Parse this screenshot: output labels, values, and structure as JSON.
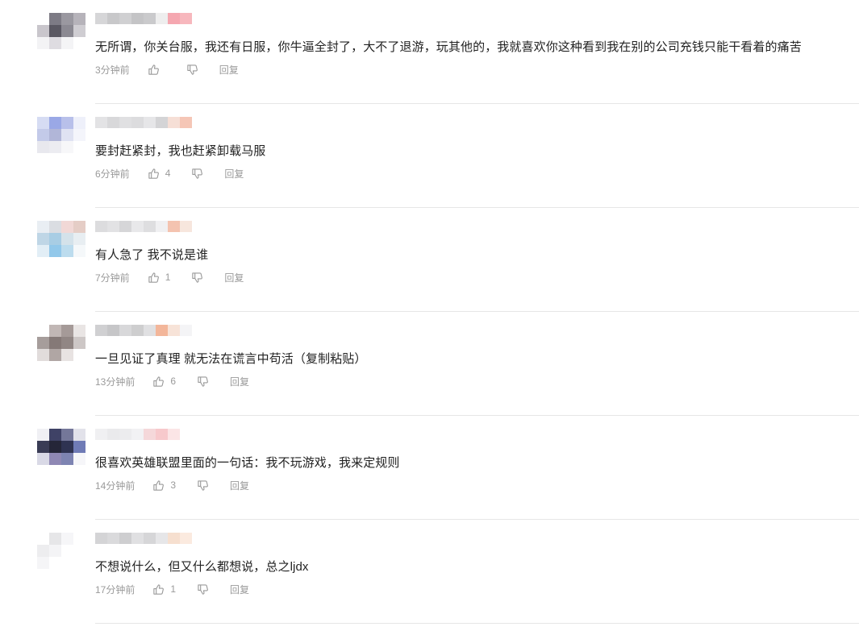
{
  "comments": [
    {
      "text": "无所谓，你关台服，我还有日服，你牛逼全封了，大不了退游，玩其他的，我就喜欢你这种看到我在别的公司充钱只能干看着的痛苦",
      "time": "3分钟前",
      "likes": "",
      "reply_label": "回复",
      "avatar_colors": [
        "#ffffff",
        "#7d7b85",
        "#9a98a0",
        "#b6b3ba",
        "#c9c6cc",
        "#5a5862",
        "#8b8992",
        "#cfcdd2",
        "#f3f3f5",
        "#dedce1",
        "#f4f4f6",
        "#ffffff"
      ],
      "name_colors": [
        "#d6d6d8",
        "#c8c8ca",
        "#d0d0d2",
        "#c4c4c6",
        "#cacacc",
        "#eeeeee",
        "#f5a7b0",
        "#f7b7bd"
      ]
    },
    {
      "text": "要封赶紧封，我也赶紧卸载马服",
      "time": "6分钟前",
      "likes": "4",
      "reply_label": "回复",
      "avatar_colors": [
        "#d6dcf3",
        "#9aa8e6",
        "#b8c0ea",
        "#eef0fa",
        "#c3cae9",
        "#b1b6d8",
        "#dfe2f2",
        "#f4f5fb",
        "#e8e8ee",
        "#ececf1",
        "#f7f7f9",
        "#ffffff"
      ],
      "name_colors": [
        "#e3e3e5",
        "#d8d8da",
        "#e0e0e2",
        "#dcdcde",
        "#e6e6e8",
        "#d4d4d6",
        "#f6dfd6",
        "#f5c6b6"
      ]
    },
    {
      "text": "有人急了 我不说是谁",
      "time": "7分钟前",
      "likes": "1",
      "reply_label": "回复",
      "avatar_colors": [
        "#e9eef3",
        "#dadde2",
        "#f1d8d6",
        "#e5cdc6",
        "#bfd6e6",
        "#a8cde4",
        "#d4e2ea",
        "#e8eef2",
        "#e2eef6",
        "#92c8ea",
        "#bcdcee",
        "#f5f8fa"
      ],
      "name_colors": [
        "#dcdcde",
        "#e2e2e4",
        "#d6d6d8",
        "#e8e8ea",
        "#dedee0",
        "#f0f0f2",
        "#f4c3b0",
        "#f7e6dd"
      ]
    },
    {
      "text": "一旦见证了真理 就无法在谎言中苟活（复制粘贴）",
      "time": "13分钟前",
      "likes": "6",
      "reply_label": "回复",
      "avatar_colors": [
        "#ffffff",
        "#c1b7b5",
        "#a59a98",
        "#e9e5e4",
        "#a69d9b",
        "#857977",
        "#918684",
        "#cdc7c6",
        "#e1dcdb",
        "#b0a6a4",
        "#e8e3e2",
        "#ffffff"
      ],
      "name_colors": [
        "#d0d0d2",
        "#c6c6c8",
        "#d8d8da",
        "#cececf",
        "#e0e0e2",
        "#f3b69a",
        "#f7e3d8",
        "#f4f4f6"
      ]
    },
    {
      "text": "很喜欢英雄联盟里面的一句话：我不玩游戏，我来定规则",
      "time": "14分钟前",
      "likes": "3",
      "reply_label": "回复",
      "avatar_colors": [
        "#f0f0f4",
        "#3f4266",
        "#747799",
        "#e2e2ea",
        "#3a3c55",
        "#252638",
        "#2f3352",
        "#6f7bb6",
        "#d9d9e6",
        "#8f88b4",
        "#7e84b2",
        "#f6f6f9"
      ],
      "name_colors": [
        "#f0f0f2",
        "#eaeaec",
        "#ececee",
        "#f2f2f4",
        "#f5d8da",
        "#f7c9cc",
        "#fbe5e6",
        "#ffffff"
      ]
    },
    {
      "text": "不想说什么，但又什么都想说，总之ljdx",
      "time": "17分钟前",
      "likes": "1",
      "reply_label": "回复",
      "avatar_colors": [
        "#ffffff",
        "#e6e6e8",
        "#f6f6f8",
        "#ffffff",
        "#ededef",
        "#f4f4f6",
        "#ffffff",
        "#ffffff",
        "#f5f5f7",
        "#ffffff",
        "#ffffff",
        "#ffffff"
      ],
      "name_colors": [
        "#d4d4d6",
        "#dadadc",
        "#ceced0",
        "#e0e0e2",
        "#d6d6d8",
        "#e6e6e8",
        "#f6dfcf",
        "#fbeadf"
      ]
    }
  ]
}
